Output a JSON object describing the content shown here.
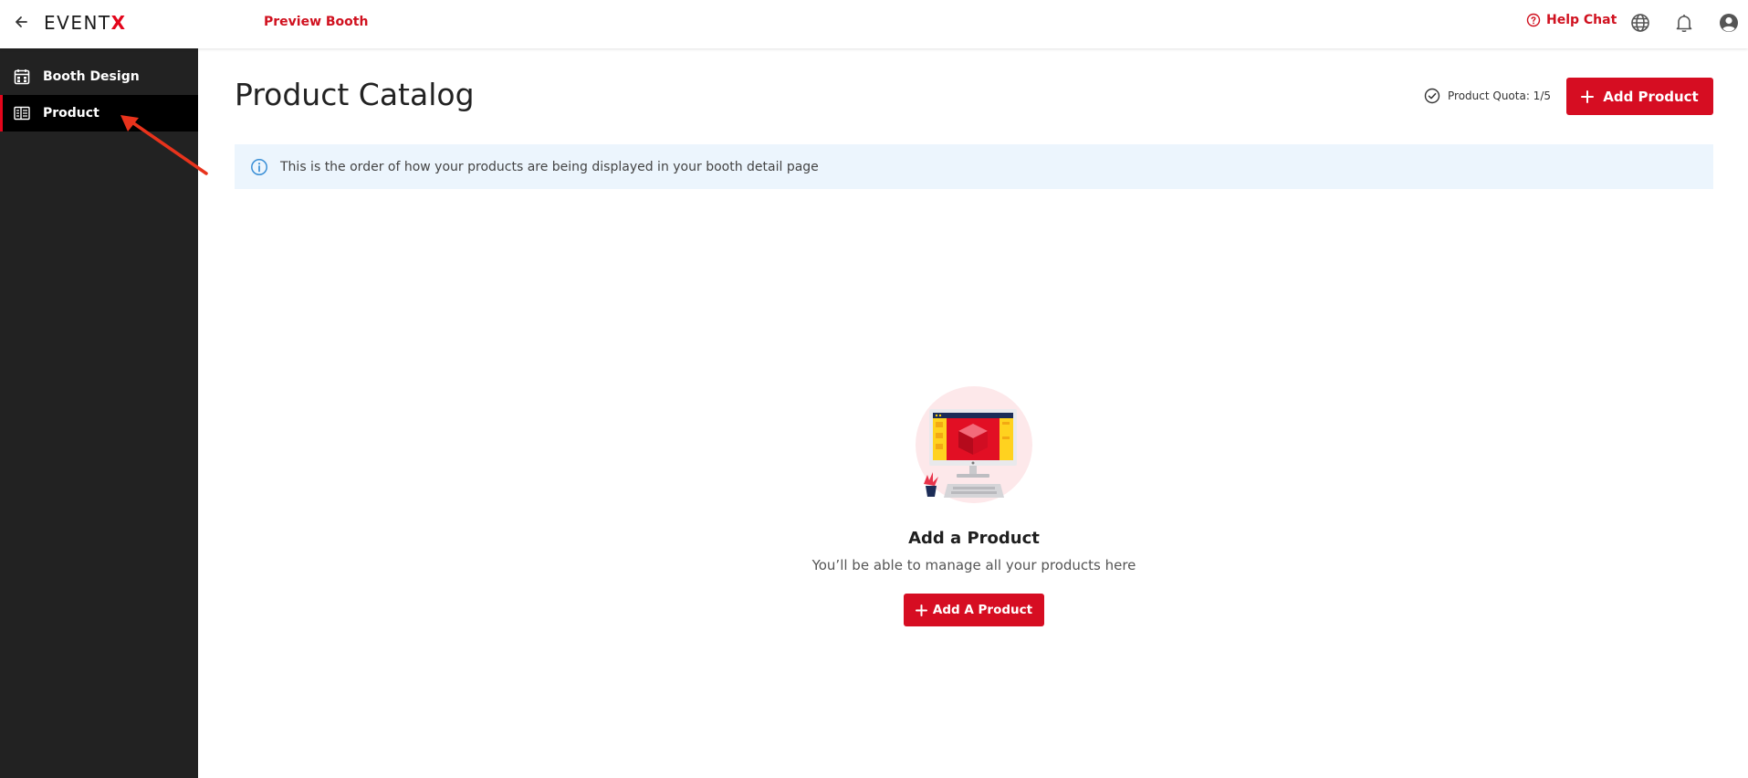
{
  "topbar": {
    "logo_main": "EVENT",
    "logo_accent": "X",
    "preview_label": "Preview Booth",
    "help_label": "Help Chat",
    "icons": [
      "back-arrow-icon",
      "help-circle-icon",
      "globe-icon",
      "bell-icon",
      "user-avatar-icon"
    ]
  },
  "sidebar": {
    "items": [
      {
        "label": "Booth Design",
        "icon": "booth-calendar-icon",
        "active": false
      },
      {
        "label": "Product",
        "icon": "product-list-icon",
        "active": true
      }
    ]
  },
  "main": {
    "title": "Product Catalog",
    "quota_label": "Product Quota: 1/5",
    "add_button_label": "Add Product",
    "info_text": "This is the order of how your products are being displayed in your booth detail page",
    "empty_state": {
      "title": "Add a Product",
      "subtitle": "You’ll be able to manage all your products here",
      "button_label": "Add A Product"
    }
  },
  "colors": {
    "accent": "#d60d22",
    "sidebar_bg": "#222222",
    "info_bg": "#ecf5fd",
    "annotation_arrow": "#e8331c"
  }
}
